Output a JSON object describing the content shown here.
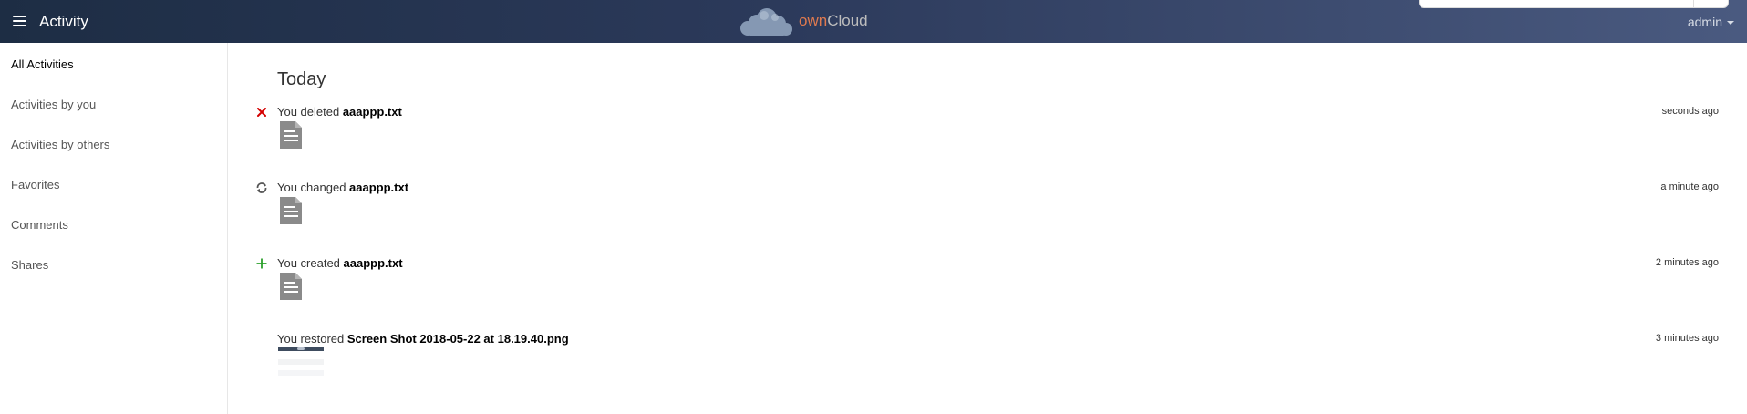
{
  "header": {
    "app_title": "Activity",
    "logo": {
      "own": "own",
      "cloud": "Cloud"
    },
    "user": "admin"
  },
  "sidebar": {
    "items": [
      {
        "label": "All Activities"
      },
      {
        "label": "Activities by you"
      },
      {
        "label": "Activities by others"
      },
      {
        "label": "Favorites"
      },
      {
        "label": "Comments"
      },
      {
        "label": "Shares"
      }
    ]
  },
  "main": {
    "section_title": "Today",
    "activities": [
      {
        "prefix": "You deleted ",
        "file": "aaappp.txt",
        "time": "seconds ago",
        "icon": "delete-icon",
        "icon_color": "#d40000"
      },
      {
        "prefix": "You changed ",
        "file": "aaappp.txt",
        "time": "a minute ago",
        "icon": "refresh-icon",
        "icon_color": "#555555"
      },
      {
        "prefix": "You created ",
        "file": "aaappp.txt",
        "time": "2 minutes ago",
        "icon": "add-icon",
        "icon_color": "#2ca02c"
      },
      {
        "prefix": "You restored ",
        "file": "Screen Shot 2018-05-22 at 18.19.40.png",
        "time": "3 minutes ago",
        "icon": "none",
        "icon_color": ""
      }
    ]
  }
}
